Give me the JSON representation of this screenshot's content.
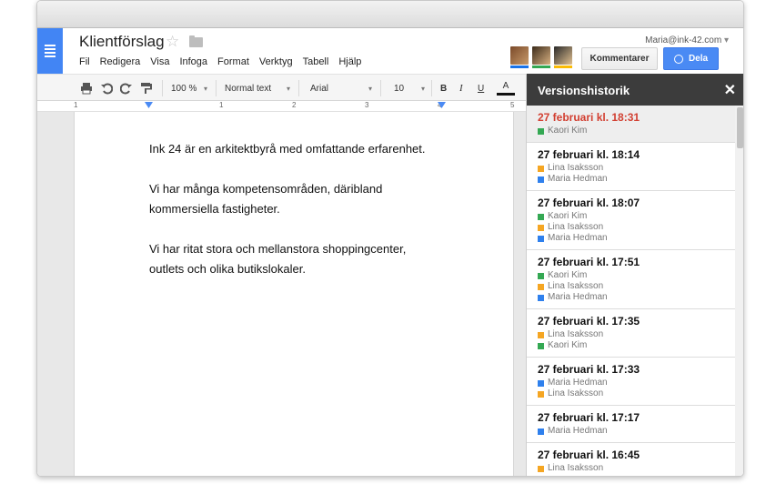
{
  "app": {
    "doc_title": "Klientförslag",
    "user_email": "Maria@ink-42.com",
    "menu": [
      "Fil",
      "Redigera",
      "Visa",
      "Infoga",
      "Format",
      "Verktyg",
      "Tabell",
      "Hjälp"
    ],
    "buttons": {
      "comment": "Kommentarer",
      "share": "Dela"
    },
    "avatar_colors": [
      "#1a73e8",
      "#34a853",
      "#fbbc05"
    ]
  },
  "toolbar": {
    "zoom": "100 %",
    "style": "Normal text",
    "font": "Arial",
    "size": "10",
    "bold": "B",
    "italic": "I",
    "underline": "U",
    "text_color": "A"
  },
  "ruler": {
    "numbers": [
      "1",
      "1",
      "2",
      "3",
      "4",
      "5"
    ]
  },
  "document": {
    "paragraphs": [
      "Ink 24 är en arkitektbyrå med omfattande erfarenhet.",
      "Vi har många kompetensområden, däribland\nkommersiella fastigheter.",
      "Vi har ritat stora och mellanstora shoppingcenter,\noutlets och olika butikslokaler."
    ]
  },
  "panel": {
    "title": "Versionshistorik",
    "close": "✕",
    "versions": [
      {
        "time": "27 februari kl. 18:31",
        "authors": [
          {
            "name": "Kaori Kim",
            "color": "#34a853"
          }
        ]
      },
      {
        "time": "27 februari kl. 18:14",
        "authors": [
          {
            "name": "Lina Isaksson",
            "color": "#f5a623"
          },
          {
            "name": "Maria Hedman",
            "color": "#2f80ed"
          }
        ]
      },
      {
        "time": "27 februari kl. 18:07",
        "authors": [
          {
            "name": "Kaori Kim",
            "color": "#34a853"
          },
          {
            "name": "Lina Isaksson",
            "color": "#f5a623"
          },
          {
            "name": "Maria Hedman",
            "color": "#2f80ed"
          }
        ]
      },
      {
        "time": "27 februari kl. 17:51",
        "authors": [
          {
            "name": "Kaori Kim",
            "color": "#34a853"
          },
          {
            "name": "Lina Isaksson",
            "color": "#f5a623"
          },
          {
            "name": "Maria Hedman",
            "color": "#2f80ed"
          }
        ]
      },
      {
        "time": "27 februari kl. 17:35",
        "authors": [
          {
            "name": "Lina Isaksson",
            "color": "#f5a623"
          },
          {
            "name": "Kaori Kim",
            "color": "#34a853"
          }
        ]
      },
      {
        "time": "27 februari kl. 17:33",
        "authors": [
          {
            "name": "Maria Hedman",
            "color": "#2f80ed"
          },
          {
            "name": "Lina Isaksson",
            "color": "#f5a623"
          }
        ]
      },
      {
        "time": "27 februari kl. 17:17",
        "authors": [
          {
            "name": "Maria Hedman",
            "color": "#2f80ed"
          }
        ]
      },
      {
        "time": "27 februari kl. 16:45",
        "authors": [
          {
            "name": "Lina Isaksson",
            "color": "#f5a623"
          }
        ]
      }
    ]
  }
}
